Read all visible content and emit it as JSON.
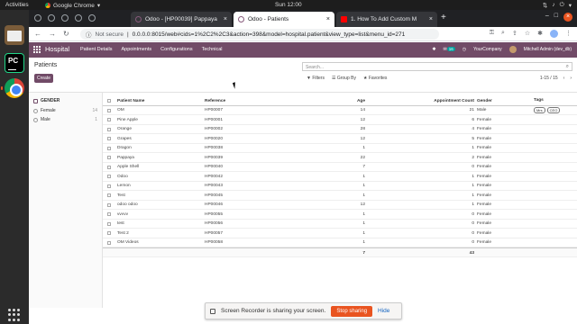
{
  "system": {
    "activities": "Activities",
    "app_name": "Google Chrome",
    "clock": "Sun 12:00"
  },
  "browser": {
    "tabs": [
      {
        "label": "Odoo - [HP00039] Pappaya",
        "active": false
      },
      {
        "label": "Odoo - Patients",
        "active": true
      },
      {
        "label": "1. How To Add Custom M",
        "active": false
      }
    ],
    "url_warning": "Not secure",
    "url": "0.0.0.0:8015/web#cids=1%2C2%2C3&action=398&model=hospital.patient&view_type=list&menu_id=271"
  },
  "odoo": {
    "brand": "Hospital",
    "menu": [
      "Patient Details",
      "Appointments",
      "Configurations",
      "Technical"
    ],
    "systray": {
      "badge_count": "16",
      "company": "YourCompany",
      "user": "Mitchell Admin (dev_db)"
    },
    "brand_color": "#714b67"
  },
  "control": {
    "title": "Patients",
    "create_label": "Create",
    "search_placeholder": "Search...",
    "filters_label": "Filters",
    "groupby_label": "Group By",
    "favorites_label": "Favorites",
    "pager": "1-15 / 15"
  },
  "panel": {
    "heading": "GENDER",
    "options": [
      {
        "label": "Female",
        "count": "14"
      },
      {
        "label": "Male",
        "count": "1"
      }
    ]
  },
  "list": {
    "columns": {
      "name": "Patient Name",
      "reference": "Reference",
      "age": "Age",
      "appointment_count": "Appointment Count",
      "gender": "Gender",
      "tags": "Tags"
    },
    "rows": [
      {
        "name": "OM",
        "reference": "HP00007",
        "age": "14",
        "appointments": "21",
        "gender": "Male",
        "tags": [
          "Mrs",
          "CEO"
        ]
      },
      {
        "name": "Pine Apple",
        "reference": "HP00001",
        "age": "12",
        "appointments": "6",
        "gender": "Female",
        "tags": []
      },
      {
        "name": "Orange",
        "reference": "HP00002",
        "age": "28",
        "appointments": "4",
        "gender": "Female",
        "tags": []
      },
      {
        "name": "Grapes",
        "reference": "HP00020",
        "age": "12",
        "appointments": "5",
        "gender": "Female",
        "tags": []
      },
      {
        "name": "Dragon",
        "reference": "HP00038",
        "age": "1",
        "appointments": "1",
        "gender": "Female",
        "tags": []
      },
      {
        "name": "Pappaya",
        "reference": "HP00039",
        "age": "22",
        "appointments": "2",
        "gender": "Female",
        "tags": []
      },
      {
        "name": "Apple Shell",
        "reference": "HP00040",
        "age": "7",
        "appointments": "0",
        "gender": "Female",
        "tags": []
      },
      {
        "name": "Odoo",
        "reference": "HP00042",
        "age": "1",
        "appointments": "1",
        "gender": "Female",
        "tags": []
      },
      {
        "name": "Lemon",
        "reference": "HP00043",
        "age": "1",
        "appointments": "1",
        "gender": "Female",
        "tags": []
      },
      {
        "name": "Test",
        "reference": "HP00045",
        "age": "1",
        "appointments": "1",
        "gender": "Female",
        "tags": []
      },
      {
        "name": "odoo odoo",
        "reference": "HP00046",
        "age": "12",
        "appointments": "1",
        "gender": "Female",
        "tags": []
      },
      {
        "name": "vvvvv",
        "reference": "HP00055",
        "age": "1",
        "appointments": "0",
        "gender": "Female",
        "tags": []
      },
      {
        "name": "test",
        "reference": "HP00056",
        "age": "1",
        "appointments": "0",
        "gender": "Female",
        "tags": []
      },
      {
        "name": "Test 2",
        "reference": "HP00057",
        "age": "1",
        "appointments": "0",
        "gender": "Female",
        "tags": []
      },
      {
        "name": "OM Videos",
        "reference": "HP00058",
        "age": "1",
        "appointments": "0",
        "gender": "Female",
        "tags": []
      }
    ],
    "totals": {
      "age": "7",
      "appointments": "43"
    }
  },
  "banner": {
    "message": "Screen Recorder is sharing your screen.",
    "stop_label": "Stop sharing",
    "hide_label": "Hide"
  }
}
